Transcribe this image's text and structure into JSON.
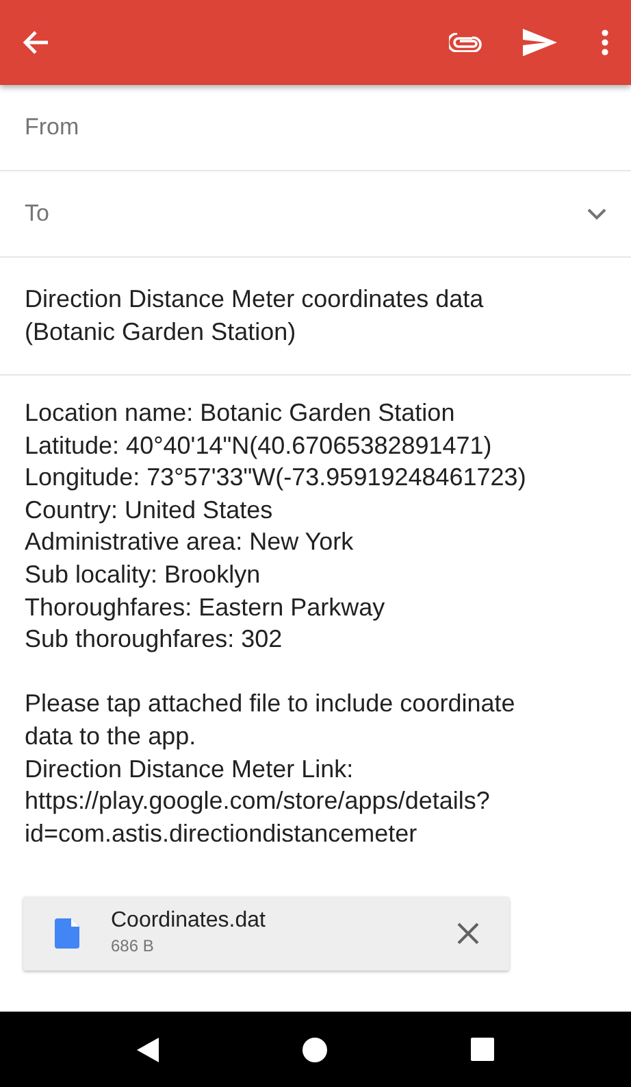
{
  "from": {
    "label": "From"
  },
  "to": {
    "label": "To",
    "expanded": false
  },
  "subject": "Direction Distance Meter coordinates data (Botanic Garden Station)",
  "body": [
    [
      "Location name: Botanic Garden Station",
      "Latitude: 40°40'14\"N(40.67065382891471)",
      "Longitude: 73°57'33\"W(-73.95919248461723)",
      "Country: United States",
      "Administrative area: New York",
      "Sub locality: Brooklyn",
      "Thoroughfares: Eastern Parkway",
      "Sub thoroughfares: 302"
    ],
    [
      "Please tap attached file to include coordinate",
      "data to the app.",
      "Direction Distance Meter Link:",
      "https://play.google.com/store/apps/details?",
      "id=com.astis.directiondistancemeter"
    ]
  ],
  "attachment": {
    "name": "Coordinates.dat",
    "size": "686 B"
  }
}
